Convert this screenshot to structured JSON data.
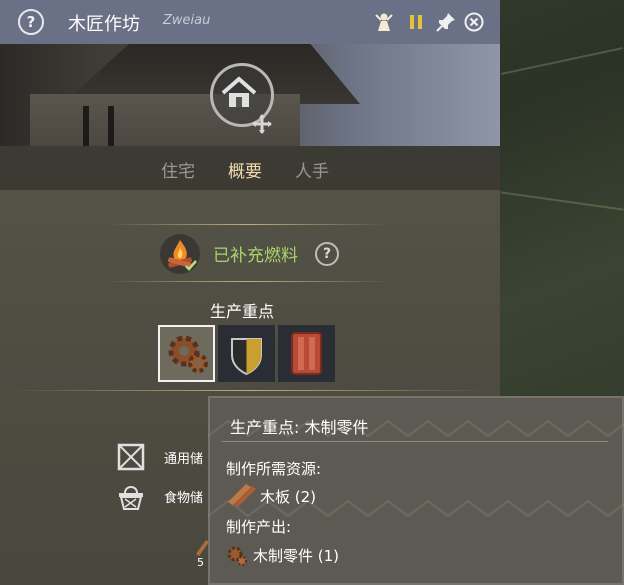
{
  "window": {
    "title": "木匠作坊",
    "subtitle": "Zweiau",
    "icons": [
      "help-icon",
      "workers-icon",
      "pause-icon",
      "pin-icon",
      "close-icon"
    ]
  },
  "tabs": [
    {
      "label": "住宅",
      "active": false
    },
    {
      "label": "概要",
      "active": true
    },
    {
      "label": "人手",
      "active": false
    }
  ],
  "fuel": {
    "status": "已补充燃料",
    "status_color": "#a8d46f"
  },
  "production": {
    "title": "生产重点",
    "options": [
      {
        "icon": "gear-parts-icon",
        "selected": true
      },
      {
        "icon": "shield-icon",
        "selected": false
      },
      {
        "icon": "wood-panel-icon",
        "selected": false
      }
    ]
  },
  "storage": {
    "rows": [
      {
        "icon": "crate-icon",
        "label": "通用储"
      },
      {
        "icon": "basket-icon",
        "label": "食物储"
      }
    ],
    "stock_count": "5"
  },
  "tooltip": {
    "title": "生产重点: 木制零件",
    "required_label": "制作所需资源:",
    "required_item": "木板 (2)",
    "output_label": "制作产出:",
    "output_item": "木制零件 (1)"
  },
  "colors": {
    "title_bar": "#6a7085",
    "active_tab": "#f0dcae",
    "fuel_green": "#a8d46f"
  }
}
